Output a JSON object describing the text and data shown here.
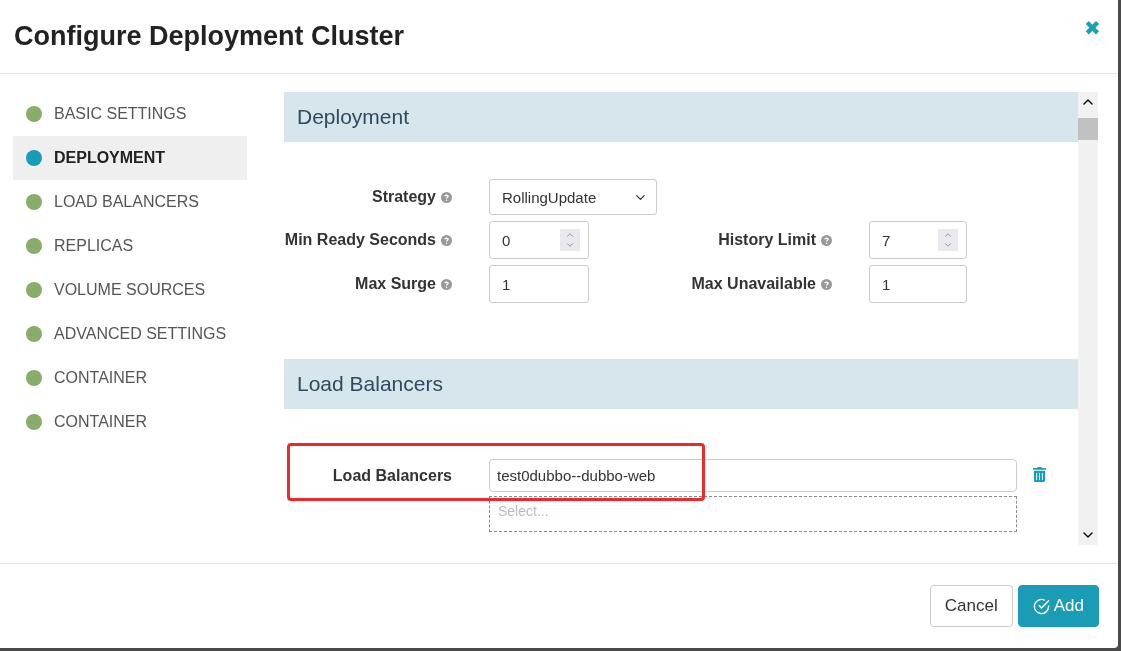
{
  "dialog": {
    "title": "Configure Deployment Cluster",
    "close": "✖"
  },
  "sidebar": {
    "items": [
      {
        "label": "BASIC SETTINGS",
        "selected": false
      },
      {
        "label": "DEPLOYMENT",
        "selected": true
      },
      {
        "label": "LOAD BALANCERS",
        "selected": false
      },
      {
        "label": "REPLICAS",
        "selected": false
      },
      {
        "label": "VOLUME SOURCES",
        "selected": false
      },
      {
        "label": "ADVANCED SETTINGS",
        "selected": false
      },
      {
        "label": "CONTAINER",
        "selected": false
      },
      {
        "label": "CONTAINER",
        "selected": false
      }
    ]
  },
  "deployment": {
    "title": "Deployment",
    "rows": [
      [
        {
          "label": "Strategy",
          "kind": "select",
          "value": "RollingUpdate",
          "help": true
        }
      ],
      [
        {
          "label": "Min Ready Seconds",
          "kind": "number",
          "value": "0",
          "help": true
        },
        {
          "label": "History Limit",
          "kind": "number",
          "value": "7",
          "help": true
        }
      ],
      [
        {
          "label": "Max Surge",
          "kind": "text",
          "value": "1",
          "help": true
        },
        {
          "label": "Max Unavailable",
          "kind": "text",
          "value": "1",
          "help": true
        }
      ]
    ]
  },
  "load_balancers": {
    "title": "Load Balancers",
    "label": "Load Balancers",
    "value": "test0dubbo--dubbo-web",
    "placeholder": "Select...",
    "highlighted": true
  },
  "footer": {
    "buttons": [
      {
        "label": "Cancel",
        "kind": "secondary"
      },
      {
        "label": "Add",
        "kind": "primary"
      }
    ]
  }
}
